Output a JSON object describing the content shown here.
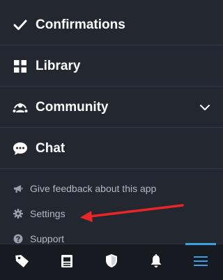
{
  "menu": {
    "items": [
      {
        "label": "Confirmations",
        "icon": "checkmark-icon"
      },
      {
        "label": "Library",
        "icon": "grid-icon"
      },
      {
        "label": "Community",
        "icon": "community-icon",
        "expandable": true
      },
      {
        "label": "Chat",
        "icon": "chat-bubble-icon"
      }
    ]
  },
  "secondary": {
    "items": [
      {
        "label": "Give feedback about this app",
        "icon": "megaphone-icon"
      },
      {
        "label": "Settings",
        "icon": "gear-icon"
      },
      {
        "label": "Support",
        "icon": "question-icon"
      }
    ]
  },
  "bottom_nav": {
    "tabs": [
      {
        "icon": "tag-icon"
      },
      {
        "icon": "news-icon"
      },
      {
        "icon": "shield-icon"
      },
      {
        "icon": "bell-icon"
      },
      {
        "icon": "hamburger-menu-icon",
        "active": true
      }
    ]
  },
  "colors": {
    "background": "#23272f",
    "bottom_bar": "#171a20",
    "accent": "#3aa0e8",
    "annotation_arrow": "#e8262a"
  }
}
